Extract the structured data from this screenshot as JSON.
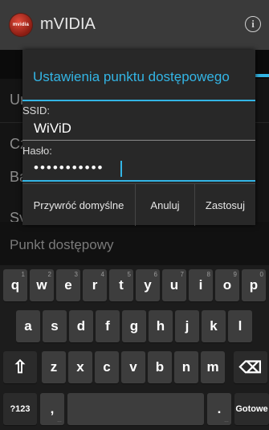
{
  "app": {
    "title": "mVIDIA",
    "logo_text": "mvidia"
  },
  "background_rows": [
    {
      "label": "Ur"
    },
    {
      "label": "Cz"
    },
    {
      "label": "Ba"
    },
    {
      "label": "Sy"
    }
  ],
  "hotspot_row": {
    "label": "Punkt dostępowy"
  },
  "dialog": {
    "title": "Ustawienia punktu dostępowego",
    "ssid_label": "SSID:",
    "ssid_value": "WiViD",
    "password_label": "Hasło:",
    "password_masked": "•••••••••••",
    "buttons": {
      "restore": "Przywróć domyślne",
      "cancel": "Anuluj",
      "apply": "Zastosuj"
    }
  },
  "keyboard": {
    "row1": [
      {
        "k": "q",
        "h": "1"
      },
      {
        "k": "w",
        "h": "2"
      },
      {
        "k": "e",
        "h": "3"
      },
      {
        "k": "r",
        "h": "4"
      },
      {
        "k": "t",
        "h": "5"
      },
      {
        "k": "y",
        "h": "6"
      },
      {
        "k": "u",
        "h": "7"
      },
      {
        "k": "i",
        "h": "8"
      },
      {
        "k": "o",
        "h": "9"
      },
      {
        "k": "p",
        "h": "0"
      }
    ],
    "row2": [
      "a",
      "s",
      "d",
      "f",
      "g",
      "h",
      "j",
      "k",
      "l"
    ],
    "row3": [
      "z",
      "x",
      "c",
      "v",
      "b",
      "n",
      "m"
    ],
    "shift_glyph": "⇧",
    "backspace_glyph": "⌫",
    "symbols_label": "?123",
    "comma_label": ",",
    "period_label": ".",
    "done_label": "Gotowe"
  },
  "colors": {
    "accent": "#33b5e5"
  }
}
